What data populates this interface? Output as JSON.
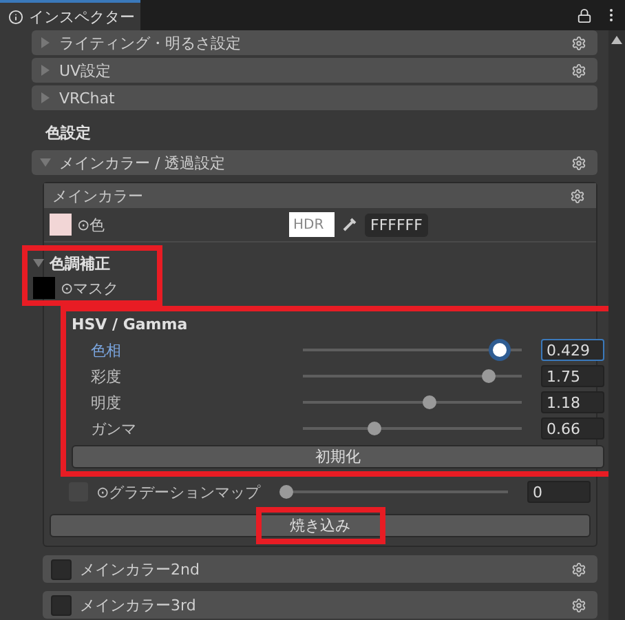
{
  "tab": {
    "title": "インスペクター",
    "selected": true
  },
  "collapsed_sections": [
    {
      "label": "ライティング・明るさ設定",
      "expanded": false
    },
    {
      "label": "UV設定",
      "expanded": false
    },
    {
      "label": "VRChat",
      "expanded": false
    }
  ],
  "category": "色設定",
  "main_section": {
    "label": "メインカラー / 透過設定",
    "expanded": true,
    "subsection": {
      "title": "メインカラー",
      "color_row": {
        "label": "⊙色",
        "hdr": "HDR",
        "hex": "FFFFFF"
      },
      "adjust": {
        "title": "色調補正",
        "expanded": true,
        "highlighted": true,
        "mask_label": "⊙マスク"
      },
      "hsv": {
        "title": "HSV / Gamma",
        "highlighted": true,
        "reset": "初期化",
        "sliders": [
          {
            "label": "色相",
            "level": 0.9,
            "value": "0.429",
            "focused": true
          },
          {
            "label": "彩度",
            "level": 0.85,
            "value": "1.75",
            "focused": false
          },
          {
            "label": "明度",
            "level": 0.58,
            "value": "1.18",
            "focused": false
          },
          {
            "label": "ガンマ",
            "level": 0.33,
            "value": "0.66",
            "focused": false
          }
        ]
      },
      "gradient": {
        "label": "⊙グラデーションマップ",
        "enabled": false,
        "level": 0,
        "value": "0"
      },
      "bake": {
        "label": "焼き込み",
        "highlighted": true
      }
    }
  },
  "toggle_sections": [
    {
      "label": "メインカラー2nd",
      "checked": false
    },
    {
      "label": "メインカラー3rd",
      "checked": false
    }
  ]
}
